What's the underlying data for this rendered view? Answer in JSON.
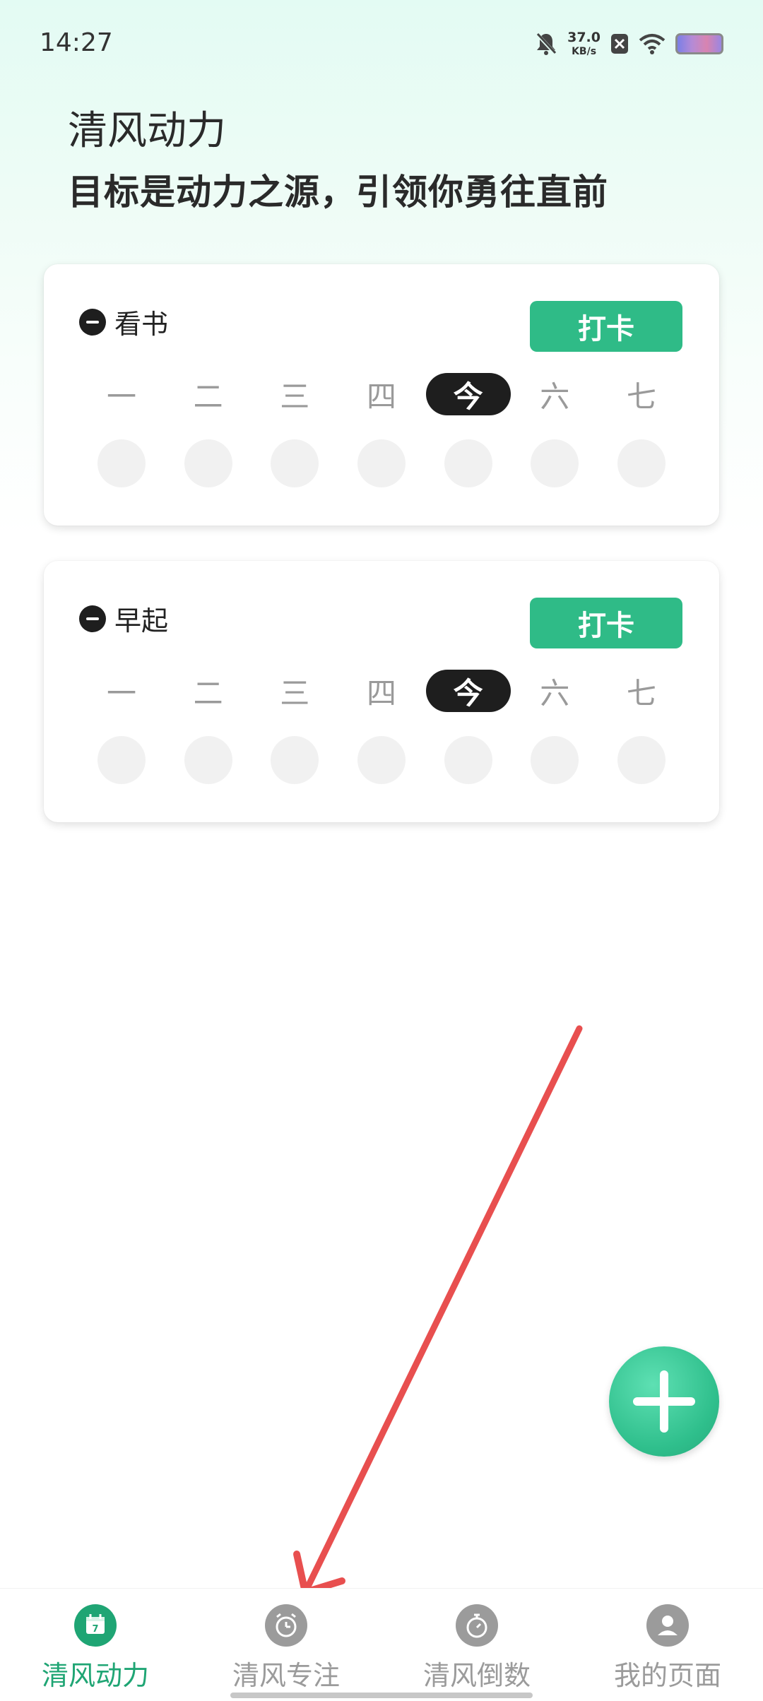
{
  "status_bar": {
    "time": "14:27",
    "net_speed_value": "37.0",
    "net_speed_unit": "KB/s",
    "icons": [
      "bell-muted-icon",
      "x-icon",
      "wifi-icon",
      "battery-icon"
    ]
  },
  "header": {
    "title": "清风动力",
    "subtitle": "目标是动力之源，引领你勇往直前"
  },
  "habits": [
    {
      "name": "看书",
      "checkin_label": "打卡",
      "days": [
        "一",
        "二",
        "三",
        "四",
        "今",
        "六",
        "七"
      ]
    },
    {
      "name": "早起",
      "checkin_label": "打卡",
      "days": [
        "一",
        "二",
        "三",
        "四",
        "今",
        "六",
        "七"
      ]
    }
  ],
  "bottom_nav": {
    "items": [
      {
        "label": "清风动力",
        "icon": "calendar-icon",
        "active": true
      },
      {
        "label": "清风专注",
        "icon": "alarm-clock-icon",
        "active": false
      },
      {
        "label": "清风倒数",
        "icon": "stopwatch-icon",
        "active": false
      },
      {
        "label": "我的页面",
        "icon": "user-icon",
        "active": false
      }
    ]
  },
  "colors": {
    "accent": "#2fbb87",
    "today_chip": "#1e1e1e",
    "arrow": "#e84f4f"
  }
}
